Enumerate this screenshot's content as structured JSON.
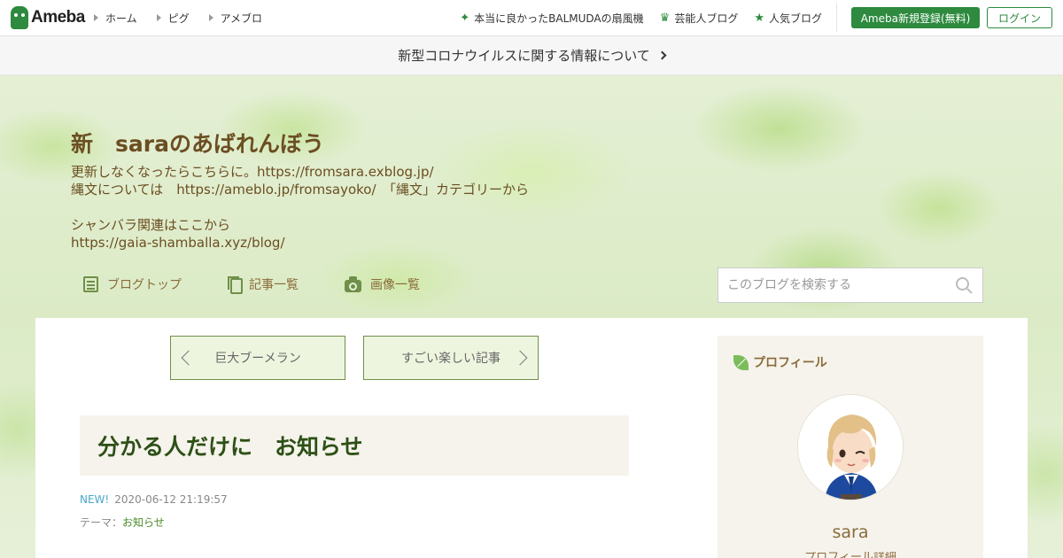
{
  "header": {
    "logo_text": "Ameba",
    "nav": [
      {
        "label": "ホーム"
      },
      {
        "label": "ピグ"
      },
      {
        "label": "アメブロ"
      }
    ],
    "right_links": [
      {
        "label": "本当に良かったBALMUDAの扇風機",
        "icon": "sparkle-icon"
      },
      {
        "label": "芸能人ブログ",
        "icon": "crown-icon"
      },
      {
        "label": "人気ブログ",
        "icon": "star-icon"
      }
    ],
    "register_label": "Ameba新規登録(無料)",
    "login_label": "ログイン"
  },
  "notice": {
    "text": "新型コロナウイルスに関する情報について"
  },
  "blog": {
    "title": "新　saraのあばれんぼう",
    "description": "更新しなくなったらこちらに。https://fromsara.exblog.jp/\n縄文については　https://ameblo.jp/fromsayoko/　「縄文」カテゴリーから\n\nシャンバラ関連はここから\nhttps://gaia-shamballa.xyz/blog/",
    "nav": [
      {
        "label": "ブログトップ",
        "icon": "document-icon"
      },
      {
        "label": "記事一覧",
        "icon": "copy-icon"
      },
      {
        "label": "画像一覧",
        "icon": "camera-icon"
      }
    ],
    "search_placeholder": "このブログを検索する"
  },
  "pager": {
    "prev_label": "巨大ブーメラン",
    "next_label": "すごい楽しい記事"
  },
  "article": {
    "title": "分かる人だけに　お知らせ",
    "new_badge": "NEW!",
    "date": "2020-06-12 21:19:57",
    "theme_prefix": "テーマ：",
    "theme": "お知らせ"
  },
  "profile": {
    "heading": "プロフィール",
    "name": "sara",
    "more": "プロフィール詳細"
  },
  "colors": {
    "brand": "#2d8a3e",
    "title_brown": "#6b4e22",
    "article_title": "#2d5016",
    "new_badge": "#4aa8c8"
  }
}
